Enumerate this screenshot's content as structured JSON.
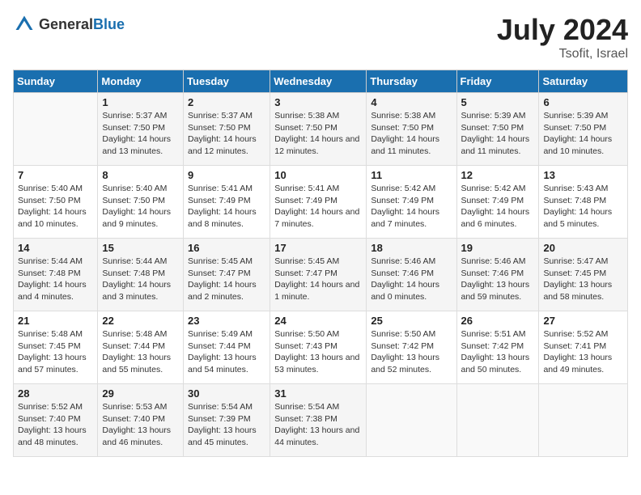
{
  "header": {
    "logo": {
      "general": "General",
      "blue": "Blue"
    },
    "title": "July 2024",
    "location": "Tsofit, Israel"
  },
  "weekdays": [
    "Sunday",
    "Monday",
    "Tuesday",
    "Wednesday",
    "Thursday",
    "Friday",
    "Saturday"
  ],
  "weeks": [
    [
      {
        "day": "",
        "sunrise": "",
        "sunset": "",
        "daylight": ""
      },
      {
        "day": "1",
        "sunrise": "Sunrise: 5:37 AM",
        "sunset": "Sunset: 7:50 PM",
        "daylight": "Daylight: 14 hours and 13 minutes."
      },
      {
        "day": "2",
        "sunrise": "Sunrise: 5:37 AM",
        "sunset": "Sunset: 7:50 PM",
        "daylight": "Daylight: 14 hours and 12 minutes."
      },
      {
        "day": "3",
        "sunrise": "Sunrise: 5:38 AM",
        "sunset": "Sunset: 7:50 PM",
        "daylight": "Daylight: 14 hours and 12 minutes."
      },
      {
        "day": "4",
        "sunrise": "Sunrise: 5:38 AM",
        "sunset": "Sunset: 7:50 PM",
        "daylight": "Daylight: 14 hours and 11 minutes."
      },
      {
        "day": "5",
        "sunrise": "Sunrise: 5:39 AM",
        "sunset": "Sunset: 7:50 PM",
        "daylight": "Daylight: 14 hours and 11 minutes."
      },
      {
        "day": "6",
        "sunrise": "Sunrise: 5:39 AM",
        "sunset": "Sunset: 7:50 PM",
        "daylight": "Daylight: 14 hours and 10 minutes."
      }
    ],
    [
      {
        "day": "7",
        "sunrise": "Sunrise: 5:40 AM",
        "sunset": "Sunset: 7:50 PM",
        "daylight": "Daylight: 14 hours and 10 minutes."
      },
      {
        "day": "8",
        "sunrise": "Sunrise: 5:40 AM",
        "sunset": "Sunset: 7:50 PM",
        "daylight": "Daylight: 14 hours and 9 minutes."
      },
      {
        "day": "9",
        "sunrise": "Sunrise: 5:41 AM",
        "sunset": "Sunset: 7:49 PM",
        "daylight": "Daylight: 14 hours and 8 minutes."
      },
      {
        "day": "10",
        "sunrise": "Sunrise: 5:41 AM",
        "sunset": "Sunset: 7:49 PM",
        "daylight": "Daylight: 14 hours and 7 minutes."
      },
      {
        "day": "11",
        "sunrise": "Sunrise: 5:42 AM",
        "sunset": "Sunset: 7:49 PM",
        "daylight": "Daylight: 14 hours and 7 minutes."
      },
      {
        "day": "12",
        "sunrise": "Sunrise: 5:42 AM",
        "sunset": "Sunset: 7:49 PM",
        "daylight": "Daylight: 14 hours and 6 minutes."
      },
      {
        "day": "13",
        "sunrise": "Sunrise: 5:43 AM",
        "sunset": "Sunset: 7:48 PM",
        "daylight": "Daylight: 14 hours and 5 minutes."
      }
    ],
    [
      {
        "day": "14",
        "sunrise": "Sunrise: 5:44 AM",
        "sunset": "Sunset: 7:48 PM",
        "daylight": "Daylight: 14 hours and 4 minutes."
      },
      {
        "day": "15",
        "sunrise": "Sunrise: 5:44 AM",
        "sunset": "Sunset: 7:48 PM",
        "daylight": "Daylight: 14 hours and 3 minutes."
      },
      {
        "day": "16",
        "sunrise": "Sunrise: 5:45 AM",
        "sunset": "Sunset: 7:47 PM",
        "daylight": "Daylight: 14 hours and 2 minutes."
      },
      {
        "day": "17",
        "sunrise": "Sunrise: 5:45 AM",
        "sunset": "Sunset: 7:47 PM",
        "daylight": "Daylight: 14 hours and 1 minute."
      },
      {
        "day": "18",
        "sunrise": "Sunrise: 5:46 AM",
        "sunset": "Sunset: 7:46 PM",
        "daylight": "Daylight: 14 hours and 0 minutes."
      },
      {
        "day": "19",
        "sunrise": "Sunrise: 5:46 AM",
        "sunset": "Sunset: 7:46 PM",
        "daylight": "Daylight: 13 hours and 59 minutes."
      },
      {
        "day": "20",
        "sunrise": "Sunrise: 5:47 AM",
        "sunset": "Sunset: 7:45 PM",
        "daylight": "Daylight: 13 hours and 58 minutes."
      }
    ],
    [
      {
        "day": "21",
        "sunrise": "Sunrise: 5:48 AM",
        "sunset": "Sunset: 7:45 PM",
        "daylight": "Daylight: 13 hours and 57 minutes."
      },
      {
        "day": "22",
        "sunrise": "Sunrise: 5:48 AM",
        "sunset": "Sunset: 7:44 PM",
        "daylight": "Daylight: 13 hours and 55 minutes."
      },
      {
        "day": "23",
        "sunrise": "Sunrise: 5:49 AM",
        "sunset": "Sunset: 7:44 PM",
        "daylight": "Daylight: 13 hours and 54 minutes."
      },
      {
        "day": "24",
        "sunrise": "Sunrise: 5:50 AM",
        "sunset": "Sunset: 7:43 PM",
        "daylight": "Daylight: 13 hours and 53 minutes."
      },
      {
        "day": "25",
        "sunrise": "Sunrise: 5:50 AM",
        "sunset": "Sunset: 7:42 PM",
        "daylight": "Daylight: 13 hours and 52 minutes."
      },
      {
        "day": "26",
        "sunrise": "Sunrise: 5:51 AM",
        "sunset": "Sunset: 7:42 PM",
        "daylight": "Daylight: 13 hours and 50 minutes."
      },
      {
        "day": "27",
        "sunrise": "Sunrise: 5:52 AM",
        "sunset": "Sunset: 7:41 PM",
        "daylight": "Daylight: 13 hours and 49 minutes."
      }
    ],
    [
      {
        "day": "28",
        "sunrise": "Sunrise: 5:52 AM",
        "sunset": "Sunset: 7:40 PM",
        "daylight": "Daylight: 13 hours and 48 minutes."
      },
      {
        "day": "29",
        "sunrise": "Sunrise: 5:53 AM",
        "sunset": "Sunset: 7:40 PM",
        "daylight": "Daylight: 13 hours and 46 minutes."
      },
      {
        "day": "30",
        "sunrise": "Sunrise: 5:54 AM",
        "sunset": "Sunset: 7:39 PM",
        "daylight": "Daylight: 13 hours and 45 minutes."
      },
      {
        "day": "31",
        "sunrise": "Sunrise: 5:54 AM",
        "sunset": "Sunset: 7:38 PM",
        "daylight": "Daylight: 13 hours and 44 minutes."
      },
      {
        "day": "",
        "sunrise": "",
        "sunset": "",
        "daylight": ""
      },
      {
        "day": "",
        "sunrise": "",
        "sunset": "",
        "daylight": ""
      },
      {
        "day": "",
        "sunrise": "",
        "sunset": "",
        "daylight": ""
      }
    ]
  ]
}
